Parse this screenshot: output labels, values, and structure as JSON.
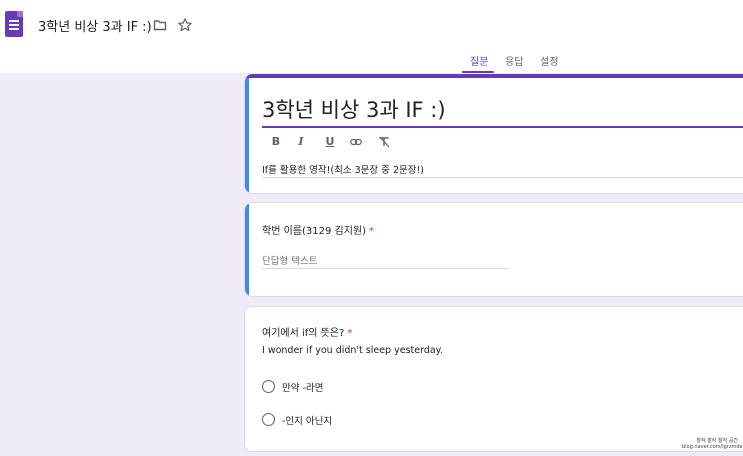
{
  "header": {
    "doc_title": "3학년 비상 3과 IF :)",
    "icons": [
      "forms-app-icon",
      "folder-icon",
      "star-icon"
    ]
  },
  "tabs": [
    {
      "label": "질문",
      "active": true
    },
    {
      "label": "응답",
      "active": false
    },
    {
      "label": "설정",
      "active": false
    }
  ],
  "form": {
    "title": "3학년 비상 3과 IF :)",
    "description": "If를 활용한 영작!(최소 3문장 중 2문장!)",
    "format_toolbar": [
      "bold-icon",
      "italic-icon",
      "underline-icon",
      "link-icon",
      "clear-format-icon"
    ]
  },
  "questions": [
    {
      "title": "학번 이름(3129 김지원)",
      "required_mark": "*",
      "placeholder": "단답형 텍스트"
    },
    {
      "title": "여기에서 if의 뜻은?",
      "required_mark": "*",
      "description": "I wonder if you didn't sleep yesterday.",
      "options": [
        "만약 -라면",
        "-인지 아닌지"
      ]
    }
  ],
  "watermark": {
    "line1": "찰칵 찰칵 찰칵 공간",
    "line2": "blog.naver.com/lgrzmde"
  },
  "colors": {
    "accent": "#673ab7",
    "focus_bar": "#4285f4",
    "background": "#f0ebf8",
    "required": "#d93025"
  }
}
